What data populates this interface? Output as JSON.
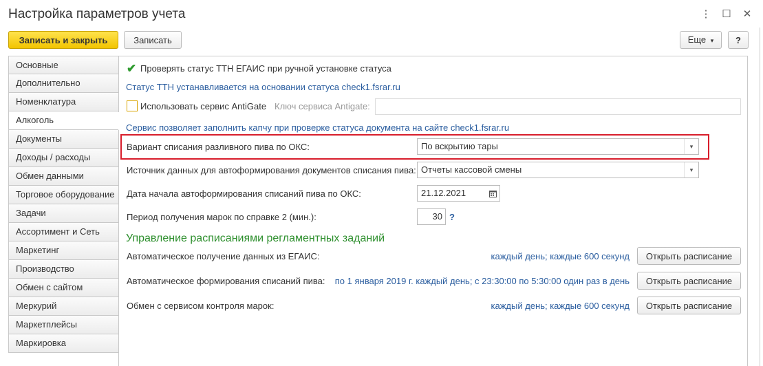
{
  "window": {
    "title": "Настройка параметров учета",
    "more_glyph": "⋮",
    "maximize_glyph": "☐",
    "close_glyph": "✕"
  },
  "toolbar": {
    "save_close_label": "Записать и закрыть",
    "save_label": "Записать",
    "more_label": "Еще",
    "more_arrow": "▾",
    "help_label": "?"
  },
  "sidebar": {
    "items": [
      {
        "label": "Основные"
      },
      {
        "label": "Дополнительно"
      },
      {
        "label": "Номенклатура"
      },
      {
        "label": "Алкоголь"
      },
      {
        "label": "Документы"
      },
      {
        "label": "Доходы / расходы"
      },
      {
        "label": "Обмен данными"
      },
      {
        "label": "Торговое оборудование"
      },
      {
        "label": "Задачи"
      },
      {
        "label": "Ассортимент и Сеть"
      },
      {
        "label": "Маркетинг"
      },
      {
        "label": "Производство"
      },
      {
        "label": "Обмен с сайтом"
      },
      {
        "label": "Меркурий"
      },
      {
        "label": "Маркетплейсы"
      },
      {
        "label": "Маркировка"
      }
    ],
    "active_label": "Алкоголь"
  },
  "main": {
    "check_ttn_label": "Проверять статус ТТН ЕГАИС при ручной установке статуса",
    "check_ttn_checked": true,
    "ttn_hint": "Статус ТТН устанавливается на основании статуса check1.fsrar.ru",
    "antigate_label": "Использовать сервис AntiGate",
    "antigate_checked": false,
    "antigate_key_label": "Ключ сервиса Antigate:",
    "antigate_key_value": "",
    "antigate_hint": "Сервис позволяет заполнить капчу при проверке статуса документа на сайте check1.fsrar.ru",
    "writeoff_variant_label": "Вариант списания разливного пива по ОКС:",
    "writeoff_variant_value": "По вскрытию тары",
    "data_source_label": "Источник данных для автоформирования документов списания пива:",
    "data_source_value": "Отчеты кассовой смены",
    "start_date_label": "Дата начала автоформирования списаний пива по ОКС:",
    "start_date_value": "21.12.2021",
    "period_label": "Период получения марок по справке 2 (мин.):",
    "period_value": "30",
    "period_help": "?",
    "dropdown_arrow": "▾",
    "schedule_heading": "Управление расписаниями регламентных заданий",
    "schedules": [
      {
        "label": "Автоматическое получение данных из ЕГАИС:",
        "schedule": "каждый день; каждые 600 секунд",
        "button": "Открыть расписание"
      },
      {
        "label": "Автоматическое формирования списаний пива:",
        "schedule": "по 1 января 2019 г. каждый день; с 23:30:00 по 5:30:00 один раз в день",
        "button": "Открыть расписание"
      },
      {
        "label": "Обмен с сервисом контроля марок:",
        "schedule": "каждый день; каждые 600 секунд",
        "button": "Открыть расписание"
      }
    ]
  },
  "colors": {
    "primary_button": "#f2c400",
    "link_blue": "#2a5d9f",
    "heading_green": "#2d8f2d",
    "highlight_red": "#d81d2b"
  }
}
